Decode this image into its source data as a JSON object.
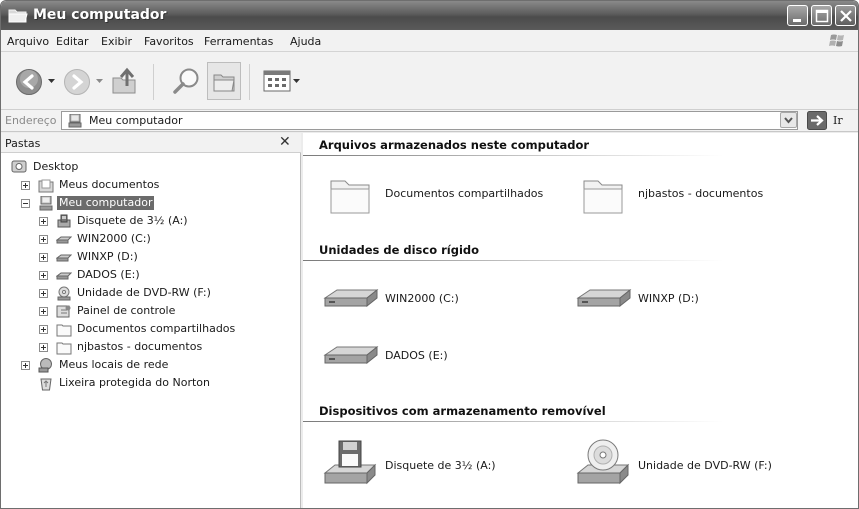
{
  "window": {
    "title": "Meu computador"
  },
  "menu": [
    "Arquivo",
    "Editar",
    "Exibir",
    "Favoritos",
    "Ferramentas",
    "Ajuda"
  ],
  "address": {
    "label": "Endereço",
    "value": "Meu computador",
    "go_label": "Ir"
  },
  "folders_pane": {
    "title": "Pastas",
    "tree": [
      {
        "label": "Desktop",
        "icon": "desktop-icon"
      },
      {
        "label": "Meus documentos",
        "icon": "folder-documents-icon"
      },
      {
        "label": "Meu computador",
        "icon": "computer-icon",
        "selected": true
      },
      {
        "label": "Disquete de 3½ (A:)",
        "icon": "floppy-icon"
      },
      {
        "label": "WIN2000 (C:)",
        "icon": "hard-drive-icon"
      },
      {
        "label": "WINXP (D:)",
        "icon": "hard-drive-icon"
      },
      {
        "label": "DADOS (E:)",
        "icon": "hard-drive-icon"
      },
      {
        "label": "Unidade de DVD-RW (F:)",
        "icon": "dvd-drive-icon"
      },
      {
        "label": "Painel de controle",
        "icon": "control-panel-icon"
      },
      {
        "label": "Documentos compartilhados",
        "icon": "folder-icon"
      },
      {
        "label": "njbastos - documentos",
        "icon": "folder-icon"
      },
      {
        "label": "Meus locais de rede",
        "icon": "network-icon"
      },
      {
        "label": "Lixeira protegida do Norton",
        "icon": "recycle-bin-icon"
      }
    ]
  },
  "content": {
    "sections": [
      {
        "title": "Arquivos armazenados neste computador",
        "items": [
          {
            "label": "Documentos compartilhados",
            "icon": "folder-icon"
          },
          {
            "label": "njbastos - documentos",
            "icon": "folder-icon"
          }
        ]
      },
      {
        "title": "Unidades de disco rígido",
        "items": [
          {
            "label": "WIN2000 (C:)",
            "icon": "hard-drive-icon"
          },
          {
            "label": "WINXP (D:)",
            "icon": "hard-drive-icon"
          },
          {
            "label": "DADOS (E:)",
            "icon": "hard-drive-icon"
          }
        ]
      },
      {
        "title": "Dispositivos com armazenamento removível",
        "items": [
          {
            "label": "Disquete de 3½ (A:)",
            "icon": "floppy-icon"
          },
          {
            "label": "Unidade de DVD-RW (F:)",
            "icon": "dvd-drive-icon"
          }
        ]
      }
    ]
  }
}
